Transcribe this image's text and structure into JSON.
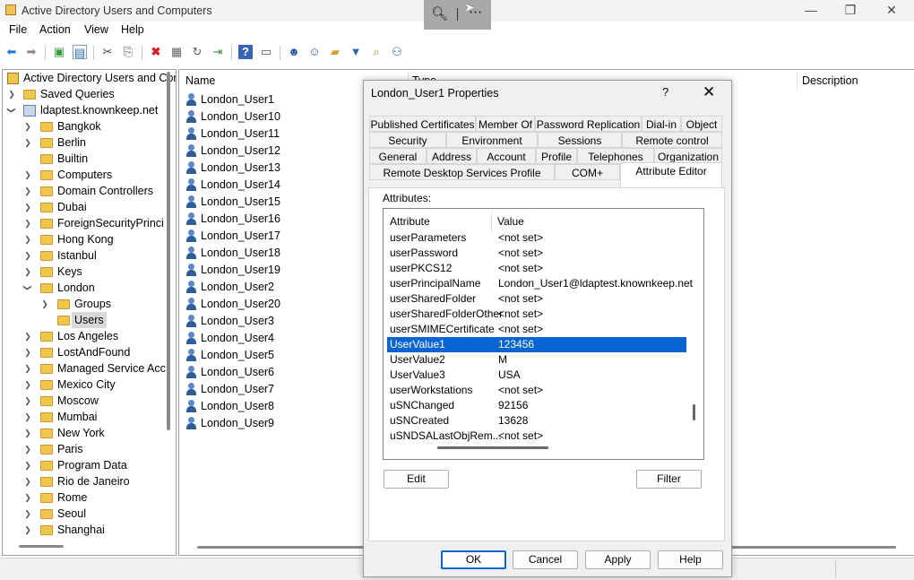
{
  "window": {
    "title": "Active Directory Users and Computers",
    "minimize": "—",
    "maximize": "❐",
    "close": "✕"
  },
  "menu": [
    "File",
    "Action",
    "View",
    "Help"
  ],
  "tree": {
    "root": "Active Directory Users and Computers",
    "items": [
      {
        "label": "Saved Queries"
      },
      {
        "label": "ldaptest.knownkeep.net"
      },
      {
        "label": "Bangkok"
      },
      {
        "label": "Berlin"
      },
      {
        "label": "Builtin"
      },
      {
        "label": "Computers"
      },
      {
        "label": "Domain Controllers"
      },
      {
        "label": "Dubai"
      },
      {
        "label": "ForeignSecurityPrinci"
      },
      {
        "label": "Hong Kong"
      },
      {
        "label": "Istanbul"
      },
      {
        "label": "Keys"
      },
      {
        "label": "London"
      },
      {
        "label": "Groups"
      },
      {
        "label": "Users"
      },
      {
        "label": "Los Angeles"
      },
      {
        "label": "LostAndFound"
      },
      {
        "label": "Managed Service Acc"
      },
      {
        "label": "Mexico City"
      },
      {
        "label": "Moscow"
      },
      {
        "label": "Mumbai"
      },
      {
        "label": "New York"
      },
      {
        "label": "Paris"
      },
      {
        "label": "Program Data"
      },
      {
        "label": "Rio de Janeiro"
      },
      {
        "label": "Rome"
      },
      {
        "label": "Seoul"
      },
      {
        "label": "Shanghai"
      }
    ]
  },
  "list": {
    "columns": [
      "Name",
      "Type",
      "Description"
    ],
    "rows": [
      "London_User1",
      "London_User10",
      "London_User11",
      "London_User12",
      "London_User13",
      "London_User14",
      "London_User15",
      "London_User16",
      "London_User17",
      "London_User18",
      "London_User19",
      "London_User2",
      "London_User20",
      "London_User3",
      "London_User4",
      "London_User5",
      "London_User6",
      "London_User7",
      "London_User8",
      "London_User9"
    ]
  },
  "dialog": {
    "title": "London_User1 Properties",
    "help": "?",
    "close": "✕",
    "tabs_row1": [
      "Published Certificates",
      "Member Of",
      "Password Replication",
      "Dial-in",
      "Object"
    ],
    "tabs_row2": [
      "Security",
      "Environment",
      "Sessions",
      "Remote control"
    ],
    "tabs_row3": [
      "General",
      "Address",
      "Account",
      "Profile",
      "Telephones",
      "Organization"
    ],
    "tabs_row4": [
      "Remote Desktop Services Profile",
      "COM+",
      "Attribute Editor"
    ],
    "active_tab": "Attribute Editor",
    "attributes_label": "Attributes:",
    "attr_columns": [
      "Attribute",
      "Value"
    ],
    "attributes": [
      {
        "name": "userParameters",
        "value": "<not set>"
      },
      {
        "name": "userPassword",
        "value": "<not set>"
      },
      {
        "name": "userPKCS12",
        "value": "<not set>"
      },
      {
        "name": "userPrincipalName",
        "value": "London_User1@ldaptest.knownkeep.net"
      },
      {
        "name": "userSharedFolder",
        "value": "<not set>"
      },
      {
        "name": "userSharedFolderOther",
        "value": "<not set>"
      },
      {
        "name": "userSMIMECertificate",
        "value": "<not set>"
      },
      {
        "name": "UserValue1",
        "value": "123456"
      },
      {
        "name": "UserValue2",
        "value": "M"
      },
      {
        "name": "UserValue3",
        "value": "USA"
      },
      {
        "name": "userWorkstations",
        "value": "<not set>"
      },
      {
        "name": "uSNChanged",
        "value": "92156"
      },
      {
        "name": "uSNCreated",
        "value": "13628"
      },
      {
        "name": "uSNDSALastObjRem...",
        "value": "<not set>"
      }
    ],
    "selected_attribute": "UserValue1",
    "edit_button": "Edit",
    "filter_button": "Filter",
    "ok_button": "OK",
    "cancel_button": "Cancel",
    "apply_button": "Apply",
    "help_button": "Help"
  }
}
